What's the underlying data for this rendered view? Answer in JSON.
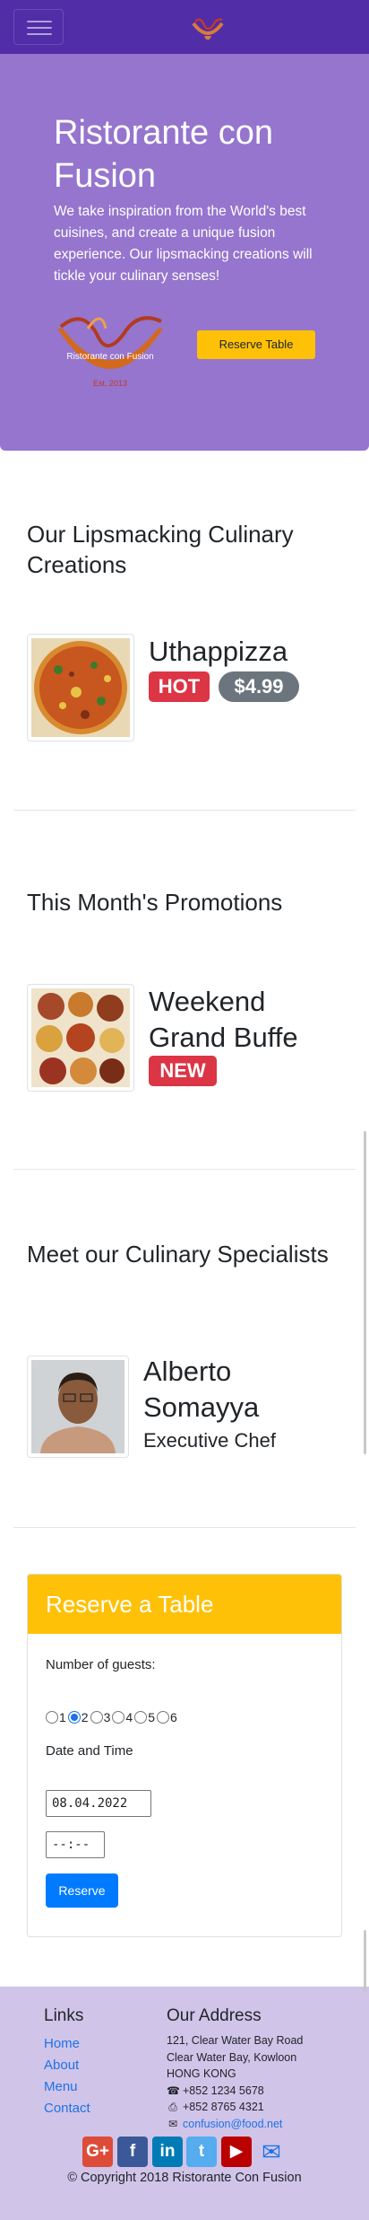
{
  "navbar": {
    "toggler_icon": "hamburger-menu-icon",
    "logo_icon": "restaurant-logo-icon"
  },
  "jumbotron": {
    "title": "Ristorante con Fusion",
    "description": "We take inspiration from the World's best cuisines, and create a unique fusion experience. Our lipsmacking creations will tickle your culinary senses!",
    "logo_text": "Ristorante con Fusion",
    "logo_subtext": "Est. 2013",
    "reserve_button": "Reserve Table"
  },
  "dish_section": {
    "heading": "Our Lipsmacking Culinary Creations",
    "name": "Uthappizza",
    "badge": "HOT",
    "price": "$4.99"
  },
  "promo_section": {
    "heading": "This Month's Promotions",
    "name": "Weekend Grand Buffe",
    "badge": "NEW"
  },
  "leader_section": {
    "heading": "Meet our Culinary Specialists",
    "name": "Alberto Somayya",
    "designation": "Executive Chef"
  },
  "reserve_card": {
    "header": "Reserve a Table",
    "guests_label": "Number of guests:",
    "guest_options": [
      "1",
      "2",
      "3",
      "4",
      "5",
      "6"
    ],
    "selected_guests": "2",
    "datetime_label": "Date and Time",
    "date_value": "08.04.2022",
    "time_value": "--:--",
    "submit": "Reserve"
  },
  "footer": {
    "links_heading": "Links",
    "links": [
      "Home",
      "About",
      "Menu",
      "Contact"
    ],
    "address_heading": "Our Address",
    "address_lines": [
      "121, Clear Water Bay Road",
      "Clear Water Bay, Kowloon",
      "HONG KONG"
    ],
    "phone": "+852 1234 5678",
    "fax": "+852 8765 4321",
    "email": "confusion@food.net",
    "social": [
      {
        "icon": "google-plus-icon",
        "glyph": "G+",
        "color": "#dd4b39"
      },
      {
        "icon": "facebook-icon",
        "glyph": "f",
        "color": "#3b5998"
      },
      {
        "icon": "linkedin-icon",
        "glyph": "in",
        "color": "#007bb6"
      },
      {
        "icon": "twitter-icon",
        "glyph": "t",
        "color": "#55acee"
      },
      {
        "icon": "youtube-icon",
        "glyph": "▶",
        "color": "#bb0000"
      },
      {
        "icon": "mail-icon",
        "glyph": "✉",
        "color": "transparent"
      }
    ],
    "copyright": "© Copyright 2018 Ristorante Con Fusion"
  },
  "colors": {
    "navbar": "#512da8",
    "jumbotron": "#9575cd",
    "accent_yellow": "#ffc107",
    "danger": "#dc3545",
    "secondary": "#6c757d",
    "primary": "#007bff",
    "footer": "#d1c4e9"
  }
}
